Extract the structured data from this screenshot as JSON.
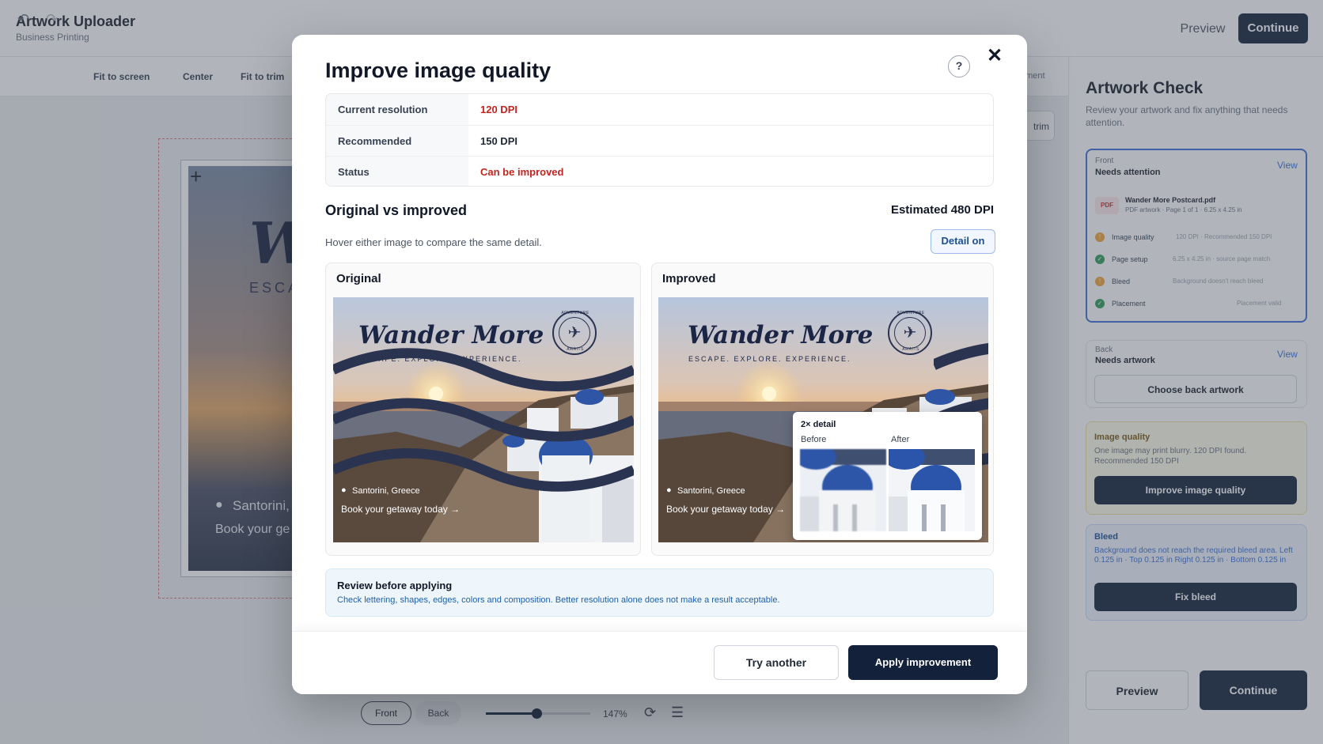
{
  "app": {
    "title": "Artwork Uploader",
    "subtitle": "Business Printing",
    "preview_label": "Preview",
    "continue_label": "Continue"
  },
  "toolbar": {
    "undo_icon": "undo-icon",
    "redo_icon": "redo-icon",
    "fit_screen": "Fit to screen",
    "center": "Center",
    "fit_trim": "Fit to trim",
    "placement": "ement",
    "trim": "trim"
  },
  "artboard": {
    "letter": "W",
    "tagline": "ESCA",
    "location": "Santorini, ",
    "book": "Book your ge"
  },
  "bottom": {
    "front": "Front",
    "back": "Back",
    "zoom": "147%",
    "zoom_fraction": 0.47
  },
  "panel": {
    "title": "Artwork Check",
    "subtitle": "Review your artwork and fix anything that needs attention.",
    "front": {
      "label": "Front",
      "status": "Needs attention",
      "view": "View",
      "file_badge": "PDF",
      "file_name": "Wander More Postcard.pdf",
      "file_meta": "PDF artwork · Page 1 of 1 · 6.25 x 4.25 in",
      "checks": [
        {
          "name": "Image quality",
          "value": "120 DPI · Recommended 150 DPI",
          "status": "warning"
        },
        {
          "name": "Page setup",
          "value": "6.25 x 4.25 in · source page match",
          "status": "ok"
        },
        {
          "name": "Bleed",
          "value": "Background doesn't reach bleed",
          "status": "warning"
        },
        {
          "name": "Placement",
          "value": "Placement valid",
          "status": "ok"
        }
      ]
    },
    "back": {
      "label": "Back",
      "status": "Needs artwork",
      "view": "View",
      "choose": "Choose back artwork"
    },
    "image_quality": {
      "title": "Image quality",
      "text": "One image may print blurry. 120 DPI found. Recommended 150 DPI",
      "button": "Improve image quality"
    },
    "bleed": {
      "title": "Bleed",
      "text": "Background does not reach the required bleed area. Left 0.125 in · Top 0.125 in Right 0.125 in · Bottom 0.125 in",
      "button": "Fix bleed"
    },
    "preview": "Preview",
    "continue": "Continue"
  },
  "modal": {
    "title": "Improve image quality",
    "help": "?",
    "close": "✕",
    "rows": [
      {
        "key": "Current resolution",
        "value": "120 DPI",
        "tone": "red"
      },
      {
        "key": "Recommended",
        "value": "150 DPI",
        "tone": "normal"
      },
      {
        "key": "Status",
        "value": "Can be improved",
        "tone": "red"
      }
    ],
    "compare_title": "Original vs improved",
    "estimate": "Estimated 480 DPI",
    "hint": "Hover either image to compare the same detail.",
    "detail_button": "Detail on",
    "original_label": "Original",
    "improved_label": "Improved",
    "photo": {
      "title": "Wander More",
      "tagline": "ESCAPE. EXPLORE. EXPERIENCE.",
      "stamp_top": "ADVENTURE",
      "stamp_bottom": "AWAITS",
      "stamp_icon": "✈",
      "location": "Santorini, Greece",
      "book": "Book your getaway today →"
    },
    "detail": {
      "title": "2× detail",
      "before": "Before",
      "after": "After"
    },
    "review": {
      "title": "Review before applying",
      "text": "Check lettering, shapes, edges, colors and composition. Better resolution alone does not make a result acceptable."
    },
    "try_another": "Try another",
    "apply": "Apply improvement"
  },
  "colors": {
    "accent": "#14213a",
    "error": "#c0261f",
    "link": "#3b6fd6"
  }
}
